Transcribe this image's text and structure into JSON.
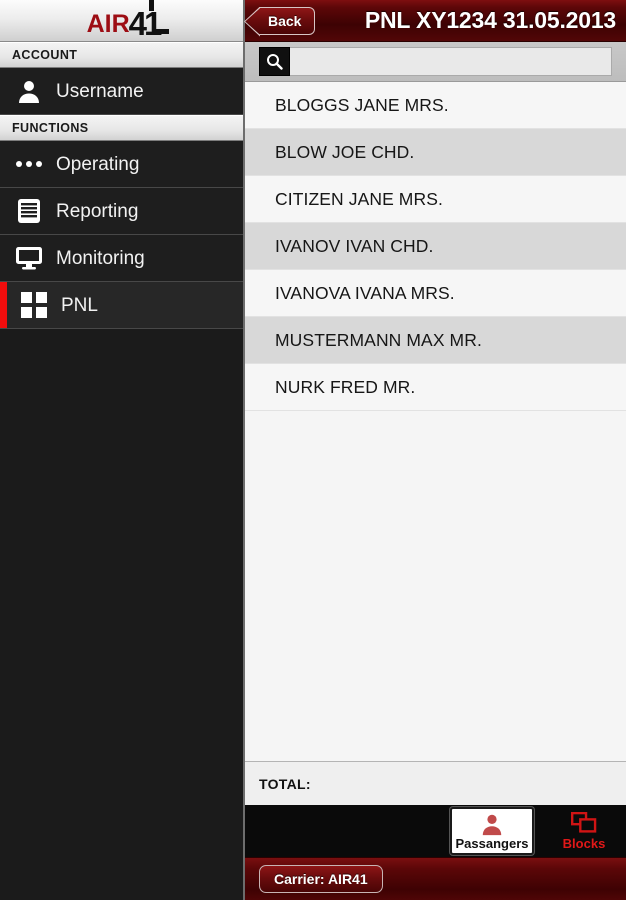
{
  "sidebar": {
    "logo": {
      "brand": "AIR",
      "number": "41"
    },
    "account_header": "ACCOUNT",
    "account_item": {
      "label": "Username",
      "icon": "user-icon"
    },
    "functions_header": "FUNCTIONS",
    "items": [
      {
        "label": "Operating",
        "icon": "dots-icon",
        "active": false
      },
      {
        "label": "Reporting",
        "icon": "document-icon",
        "active": false
      },
      {
        "label": "Monitoring",
        "icon": "monitor-icon",
        "active": false
      },
      {
        "label": "PNL",
        "icon": "grid-icon",
        "active": true
      }
    ]
  },
  "header": {
    "back_label": "Back",
    "title": "PNL XY1234 31.05.2013"
  },
  "search": {
    "icon": "search-icon",
    "value": "",
    "placeholder": ""
  },
  "passenger_list": [
    "BLOGGS JANE MRS.",
    "BLOW JOE CHD.",
    "CITIZEN JANE MRS.",
    "IVANOV IVAN CHD.",
    "IVANOVA IVANA MRS.",
    "MUSTERMANN MAX MR.",
    "NURK FRED MR."
  ],
  "total": {
    "label": "TOTAL:",
    "value": ""
  },
  "tabs": [
    {
      "label": "Passangers",
      "icon": "person-icon",
      "active": true
    },
    {
      "label": "Blocks",
      "icon": "blocks-icon",
      "active": false
    }
  ],
  "footer": {
    "carrier_label": "Carrier: AIR41"
  },
  "colors": {
    "accent_red": "#f20d0d",
    "header_red": "#5d0708",
    "logo_red": "#9d0d14",
    "tab_inactive_red": "#e01818",
    "sidebar_bg": "#1b1b1b"
  }
}
